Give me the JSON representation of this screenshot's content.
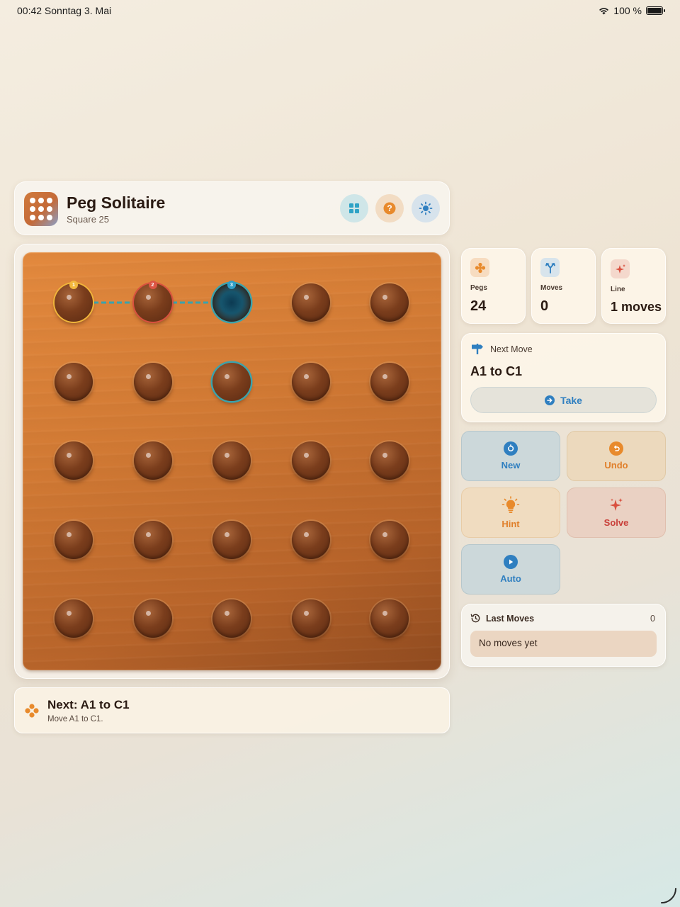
{
  "status_bar": {
    "time_date": "00:42  Sonntag 3. Mai",
    "battery": "100 %",
    "battery_level": 1.0
  },
  "header": {
    "title": "Peg Solitaire",
    "subtitle": "Square 25",
    "buttons": [
      "grid-icon",
      "help-icon",
      "brightness-icon"
    ]
  },
  "board": {
    "rows": 5,
    "cols": 5,
    "cells": [
      [
        "peg-selected-1",
        "peg-selected-2",
        "hole-target-3",
        "peg",
        "peg"
      ],
      [
        "peg",
        "peg",
        "peg-highlight",
        "peg",
        "peg"
      ],
      [
        "peg",
        "peg",
        "peg",
        "peg",
        "peg"
      ],
      [
        "peg",
        "peg",
        "peg",
        "peg",
        "peg"
      ],
      [
        "peg",
        "peg",
        "peg",
        "peg",
        "peg"
      ]
    ],
    "path_badges": [
      "1",
      "2",
      "3"
    ]
  },
  "hint_bar": {
    "title": "Next: A1 to C1",
    "subtitle": "Move A1 to C1."
  },
  "stats": [
    {
      "label": "Pegs",
      "value": "24",
      "icon": "pegs-icon"
    },
    {
      "label": "Moves",
      "value": "0",
      "icon": "branch-icon"
    },
    {
      "label": "Line",
      "value": "1 moves",
      "icon": "sparkle-icon"
    }
  ],
  "next_move": {
    "label": "Next Move",
    "value": "A1 to C1",
    "take_label": "Take"
  },
  "actions": {
    "new": "New",
    "undo": "Undo",
    "hint": "Hint",
    "solve": "Solve",
    "auto": "Auto"
  },
  "last_moves": {
    "label": "Last Moves",
    "count": "0",
    "empty_text": "No moves yet"
  },
  "colors": {
    "accent_blue": "#2f7fc0",
    "accent_orange": "#e07f2a",
    "accent_red": "#c9403a",
    "teal": "#3aa3ad",
    "board_wood": "#d27a34"
  }
}
